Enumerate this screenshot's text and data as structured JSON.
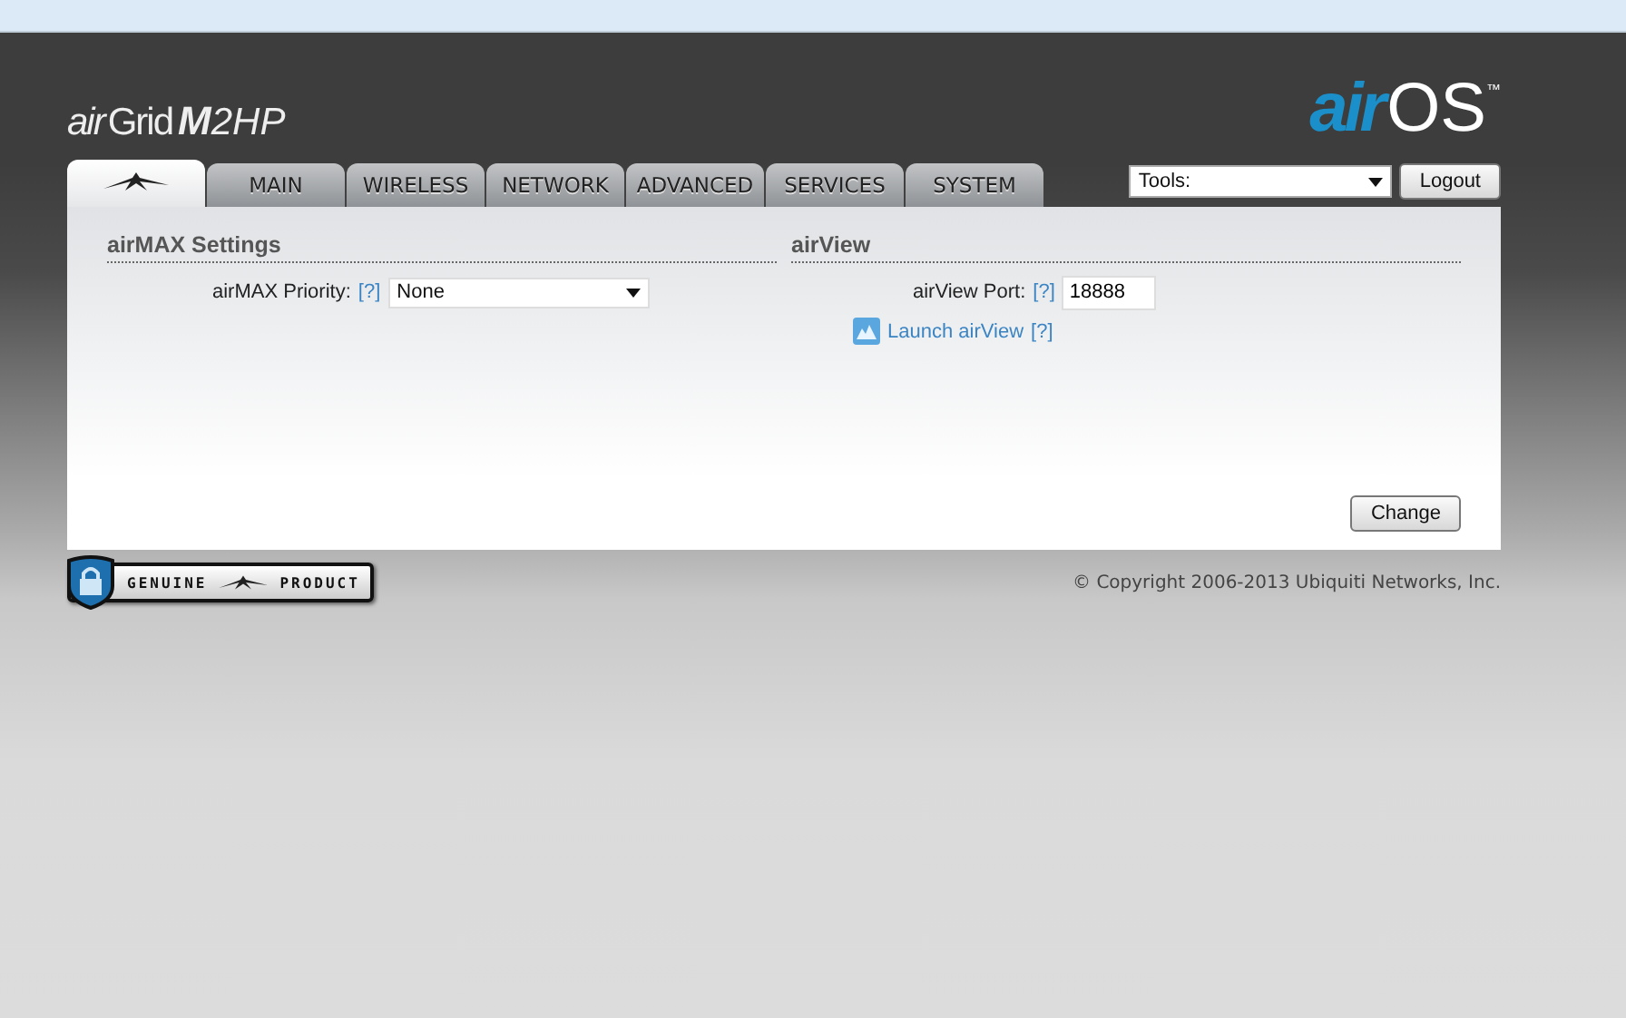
{
  "brand": {
    "prefix": "air",
    "name": "Grid",
    "model_bold": "M",
    "model": "2HP"
  },
  "os_logo": {
    "prefix": "air",
    "name": "OS",
    "mark": "™"
  },
  "tabs": [
    {
      "kind": "icon",
      "selected": true
    },
    {
      "kind": "text",
      "label": "MAIN",
      "selected": false
    },
    {
      "kind": "text",
      "label": "WIRELESS",
      "selected": false
    },
    {
      "kind": "text",
      "label": "NETWORK",
      "selected": false
    },
    {
      "kind": "text",
      "label": "ADVANCED",
      "selected": false
    },
    {
      "kind": "text",
      "label": "SERVICES",
      "selected": false
    },
    {
      "kind": "text",
      "label": "SYSTEM",
      "selected": false
    }
  ],
  "tools": {
    "value": "Tools:"
  },
  "logout_button": "Logout",
  "sections": [
    {
      "title": "airMAX Settings",
      "rows": [
        {
          "kind": "select",
          "label": "airMAX Priority:",
          "help": "[?]",
          "value": "None"
        }
      ]
    },
    {
      "title": "airView",
      "rows": [
        {
          "kind": "input",
          "label": "airView Port:",
          "help": "[?]",
          "value": "18888"
        },
        {
          "kind": "link",
          "label": "Launch airView",
          "help": "[?]"
        }
      ]
    }
  ],
  "change_button": "Change",
  "badge": {
    "left": "GENUINE",
    "right": "PRODUCT"
  },
  "copyright": "© Copyright 2006-2013 Ubiquiti Networks, Inc."
}
